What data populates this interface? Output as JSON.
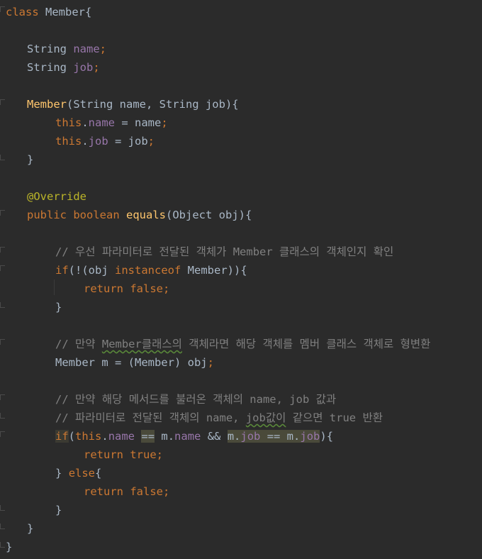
{
  "t": {
    "class_kw": "class",
    "class_name": "Member",
    "brace_open": "{",
    "brace_close": "}",
    "string_type": "String",
    "name_field": "name",
    "job_field": "job",
    "semicolon": ";",
    "ctor_name": "Member",
    "ctor_params": "(String name, String job){",
    "this_kw": "this",
    "dot": ".",
    "assign_name": " = name",
    "assign_job": " = job",
    "annotation": "@Override",
    "public_kw": "public",
    "boolean_kw": "boolean",
    "equals_fn": "equals",
    "equals_params": "(Object obj){",
    "comment1": "// 우선 파라미터로 전달된 객체가 Member 클래스의 객체인지 확인",
    "if_kw": "if",
    "if1_open": "(!(obj ",
    "instanceof_kw": "instanceof",
    "if1_close": " Member)){",
    "return_kw": "return",
    "false_kw": "false",
    "true_kw": "true",
    "comment2_a": "// 만약 ",
    "comment2_b": "Member클래스의",
    "comment2_c": " 객체라면 해당 객체를 멤버 클래스 객체로 형변환",
    "cast_line": "Member m = (Member) obj",
    "comment3": "// 만약 해당 메서드를 불러온 객체의 name, job 값과",
    "comment4_a": "// 파라미터로 전달된 객체의 name, ",
    "comment4_b": "job값이",
    "comment4_c": " 같으면 true 반환",
    "paren_open": "(",
    "eqeq": "==",
    "m_dot": " m.",
    "and_op": " && ",
    "m_job_eq": "m.",
    "eq_m": " == m.",
    "close_paren_brace": "){",
    "else_kw": "else",
    "space": " "
  }
}
